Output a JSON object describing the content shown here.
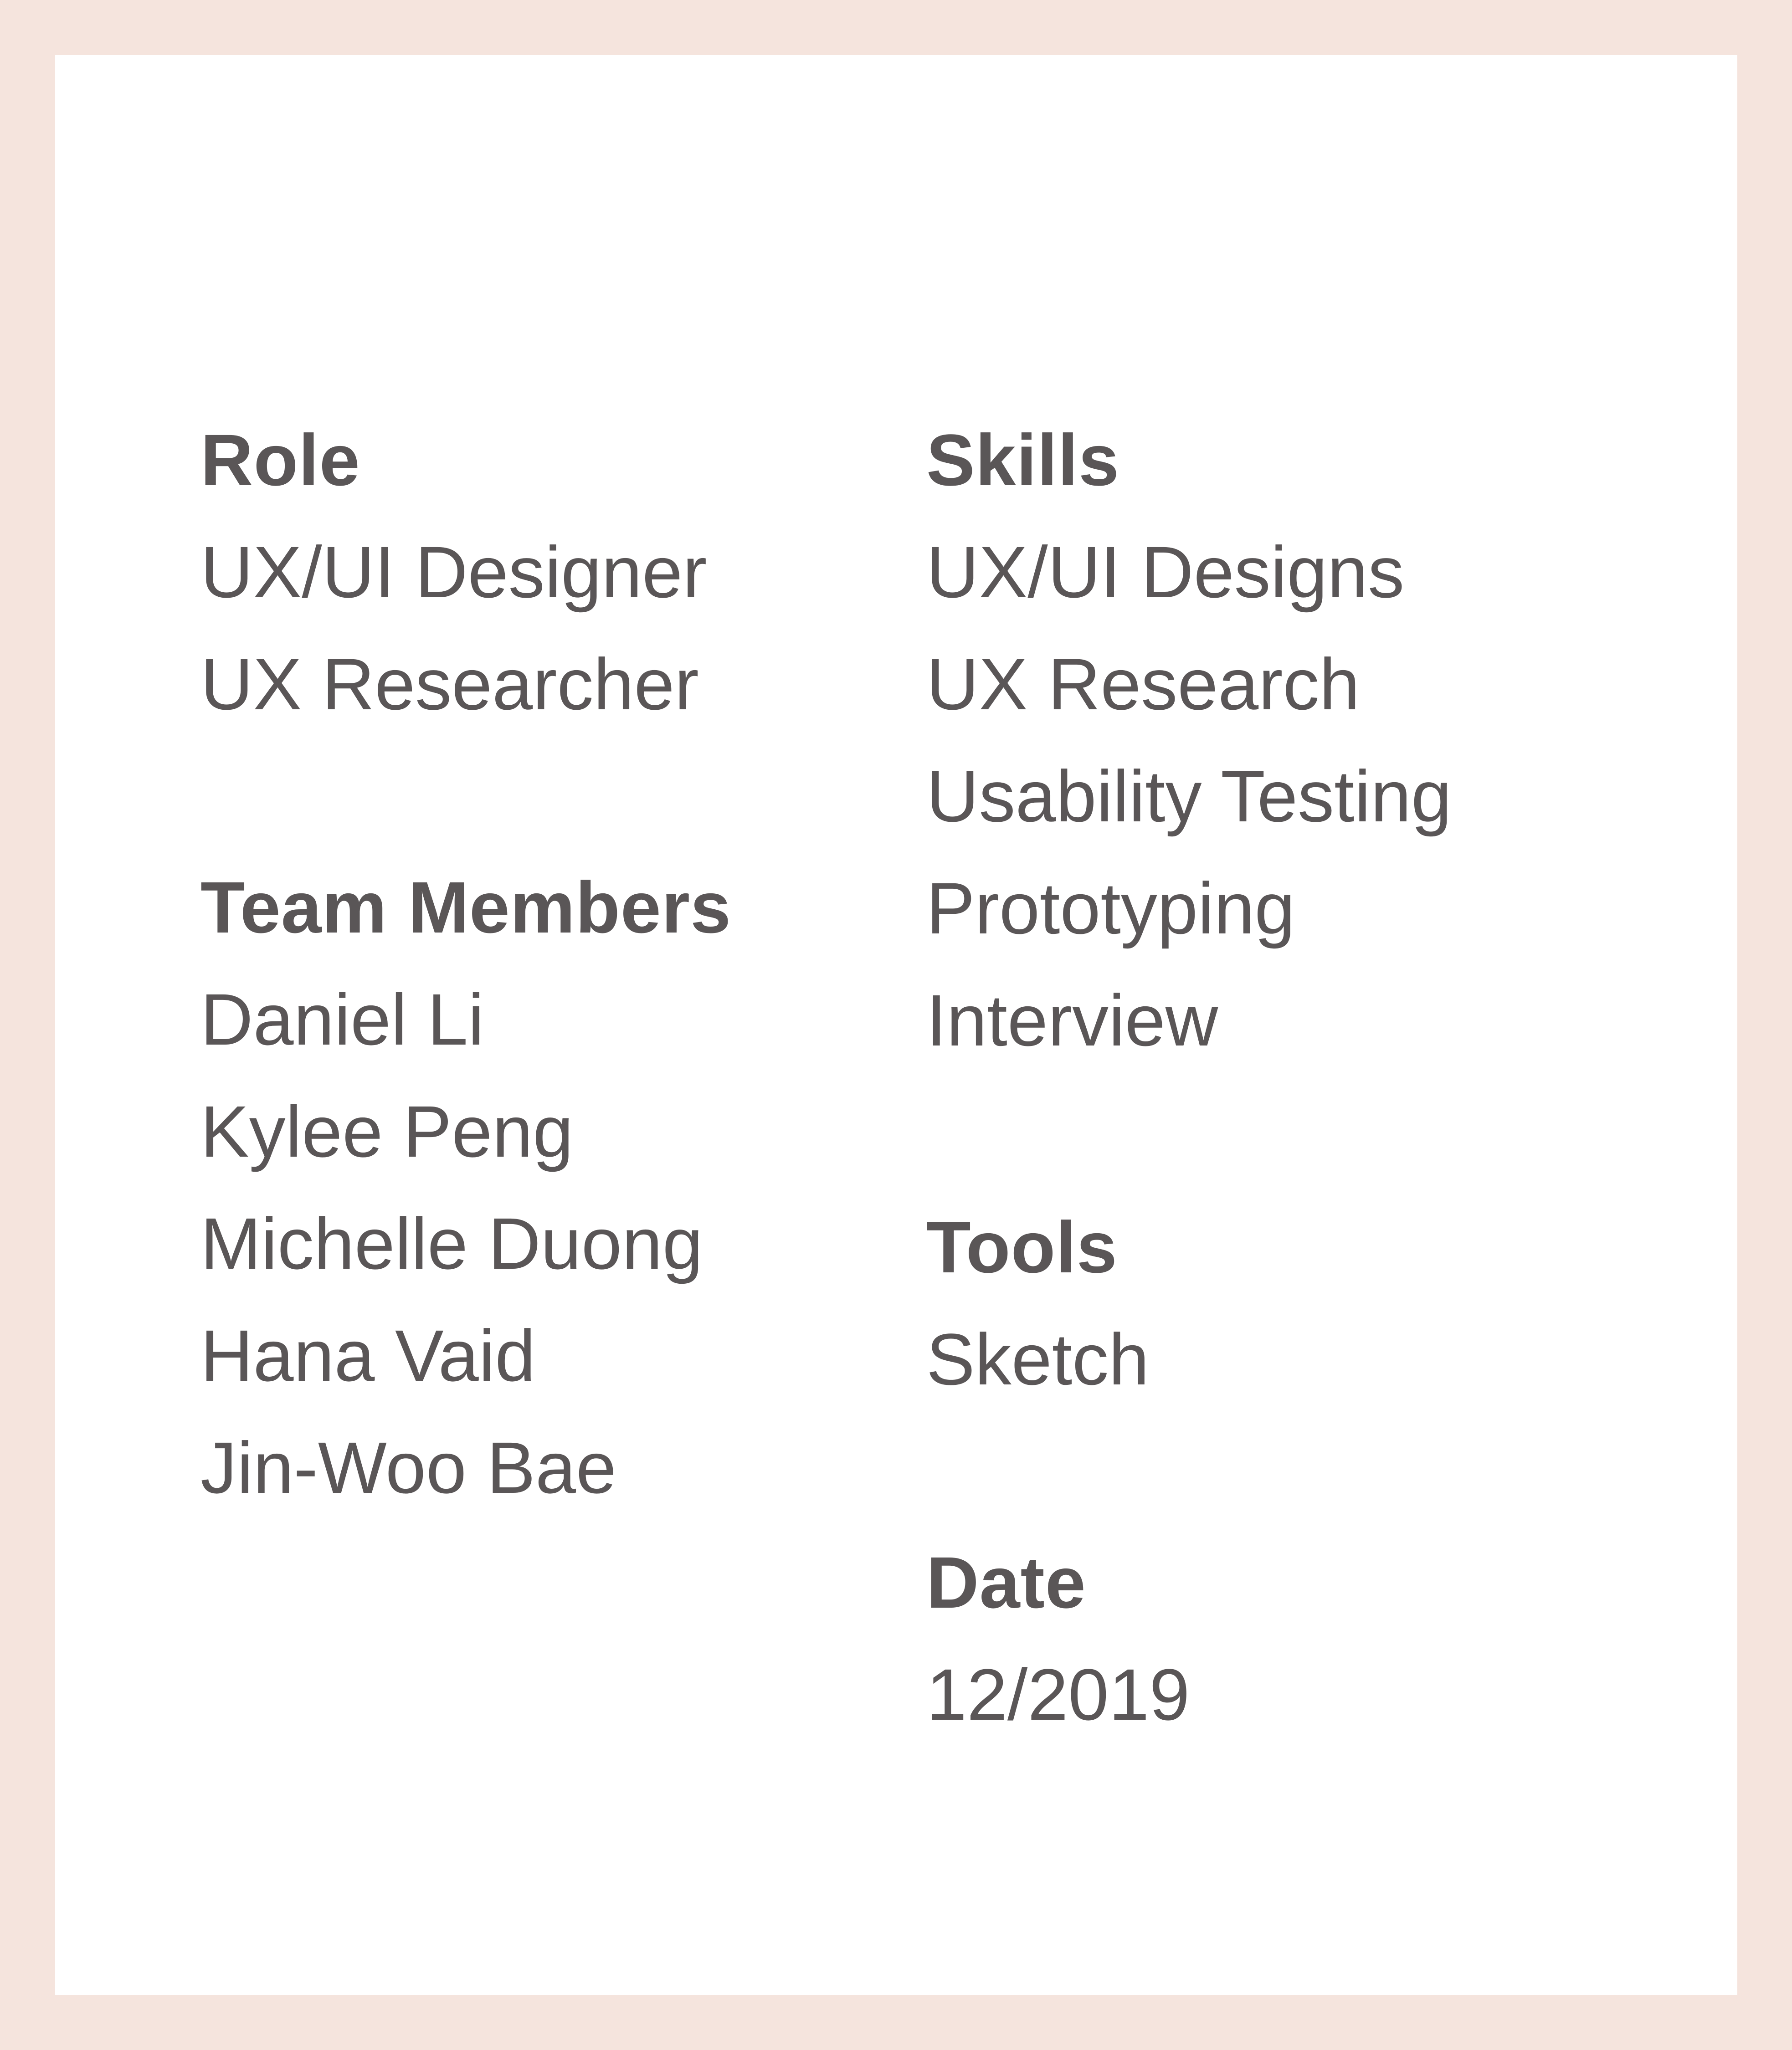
{
  "colors": {
    "border": "#f5e4dd",
    "card": "#ffffff",
    "text": "#5a5657"
  },
  "left": {
    "role": {
      "heading": "Role",
      "items": [
        "UX/UI Designer",
        "UX Researcher"
      ]
    },
    "team": {
      "heading": "Team Members",
      "items": [
        "Daniel Li",
        "Kylee Peng",
        "Michelle Duong",
        "Hana Vaid",
        "Jin-Woo Bae"
      ]
    }
  },
  "right": {
    "skills": {
      "heading": "Skills",
      "items": [
        "UX/UI Designs",
        "UX Research",
        "Usability Testing",
        "Prototyping",
        "Interview"
      ]
    },
    "tools": {
      "heading": "Tools",
      "items": [
        "Sketch"
      ]
    },
    "date": {
      "heading": "Date",
      "items": [
        "12/2019"
      ]
    }
  }
}
